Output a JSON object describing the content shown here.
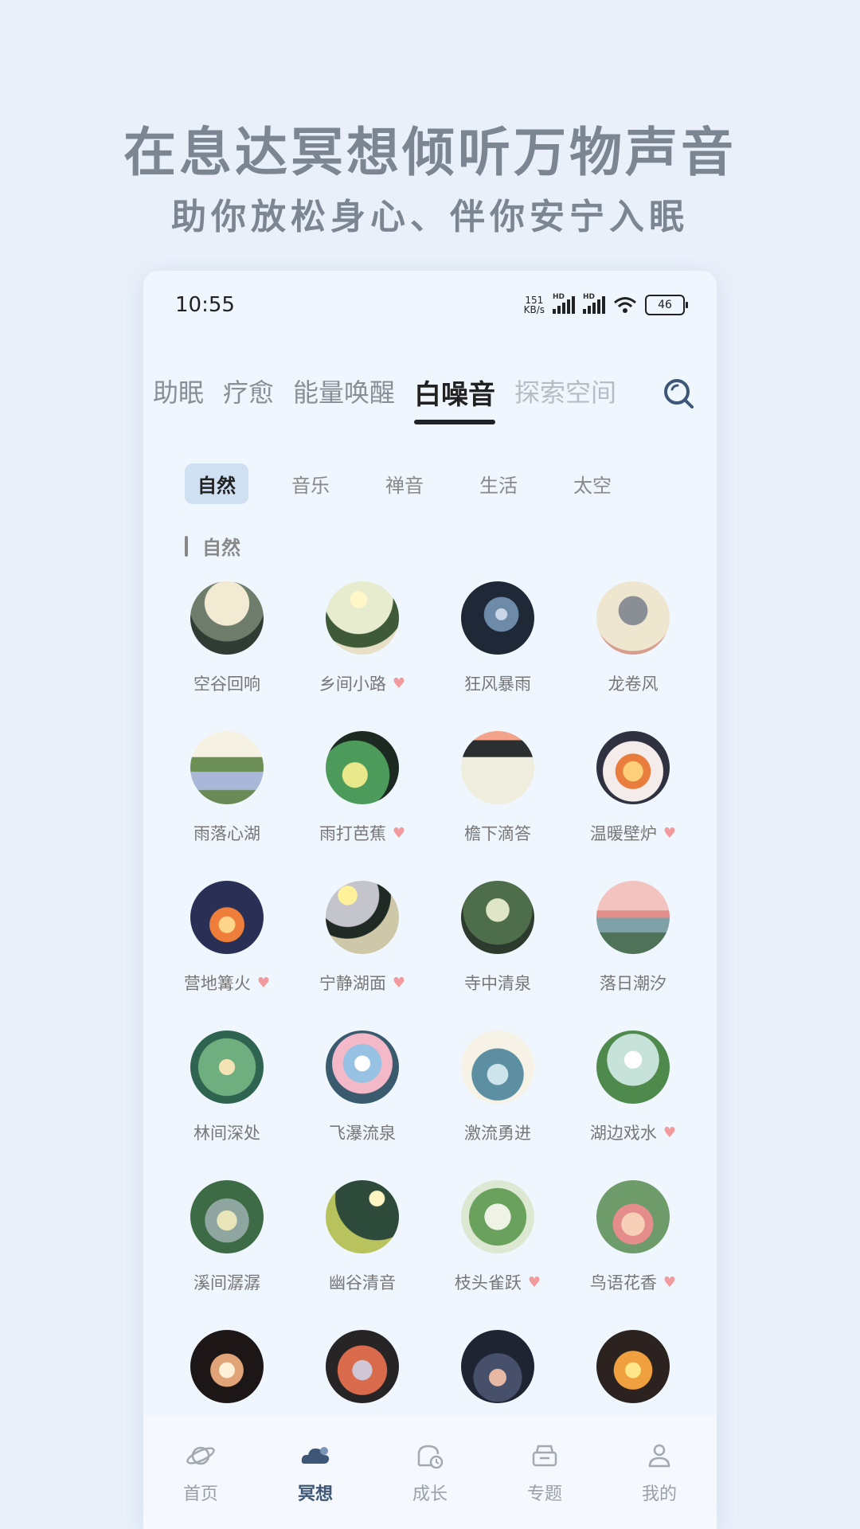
{
  "promo": {
    "headline": "在息达冥想倾听万物声音",
    "subline": "助你放松身心、伴你安宁入眠"
  },
  "status_bar": {
    "time": "10:55",
    "net_speed_value": "151",
    "net_speed_unit": "KB/s",
    "hd1": "HD",
    "hd2": "HD",
    "battery": "46"
  },
  "tabs": [
    {
      "label": "助眠"
    },
    {
      "label": "疗愈"
    },
    {
      "label": "能量唤醒"
    },
    {
      "label": "白噪音"
    },
    {
      "label": "探索空间"
    }
  ],
  "chips": [
    {
      "label": "自然"
    },
    {
      "label": "音乐"
    },
    {
      "label": "禅音"
    },
    {
      "label": "生活"
    },
    {
      "label": "太空"
    }
  ],
  "section_title": "自然",
  "sounds": [
    {
      "name": "空谷回响",
      "fav": false,
      "icon": "valley-icon"
    },
    {
      "name": "乡间小路",
      "fav": true,
      "icon": "country-road-icon"
    },
    {
      "name": "狂风暴雨",
      "fav": false,
      "icon": "storm-icon"
    },
    {
      "name": "龙卷风",
      "fav": false,
      "icon": "tornado-icon"
    },
    {
      "name": "雨落心湖",
      "fav": false,
      "icon": "rain-lake-icon"
    },
    {
      "name": "雨打芭蕉",
      "fav": true,
      "icon": "banana-leaf-icon"
    },
    {
      "name": "檐下滴答",
      "fav": false,
      "icon": "eaves-drip-icon"
    },
    {
      "name": "温暖壁炉",
      "fav": true,
      "icon": "fireplace-icon"
    },
    {
      "name": "营地篝火",
      "fav": true,
      "icon": "campfire-icon"
    },
    {
      "name": "宁静湖面",
      "fav": true,
      "icon": "calm-lake-icon"
    },
    {
      "name": "寺中清泉",
      "fav": false,
      "icon": "temple-spring-icon"
    },
    {
      "name": "落日潮汐",
      "fav": false,
      "icon": "sunset-tide-icon"
    },
    {
      "name": "林间深处",
      "fav": false,
      "icon": "forest-icon"
    },
    {
      "name": "飞瀑流泉",
      "fav": false,
      "icon": "waterfall-icon"
    },
    {
      "name": "激流勇进",
      "fav": false,
      "icon": "rapids-icon"
    },
    {
      "name": "湖边戏水",
      "fav": true,
      "icon": "lakeside-icon"
    },
    {
      "name": "溪间潺潺",
      "fav": false,
      "icon": "creek-icon"
    },
    {
      "name": "幽谷清音",
      "fav": false,
      "icon": "moon-valley-icon"
    },
    {
      "name": "枝头雀跃",
      "fav": true,
      "icon": "pine-branch-icon"
    },
    {
      "name": "鸟语花香",
      "fav": true,
      "icon": "flower-garden-icon"
    },
    {
      "name": "",
      "fav": false,
      "icon": "candle-icon"
    },
    {
      "name": "",
      "fav": false,
      "icon": "charcoal-icon"
    },
    {
      "name": "",
      "fav": false,
      "icon": "night-smoke-icon"
    },
    {
      "name": "",
      "fav": false,
      "icon": "flame-icon"
    }
  ],
  "nav": [
    {
      "label": "首页",
      "icon": "planet-icon"
    },
    {
      "label": "冥想",
      "icon": "cloud-icon"
    },
    {
      "label": "成长",
      "icon": "growth-icon"
    },
    {
      "label": "专题",
      "icon": "box-icon"
    },
    {
      "label": "我的",
      "icon": "profile-icon"
    }
  ],
  "colors": {
    "background": "#e9f0fa",
    "panel": "#eff6fe",
    "active_chip": "#cfe0f2",
    "heart": "#f29b9f",
    "nav_active": "#3e5777"
  }
}
